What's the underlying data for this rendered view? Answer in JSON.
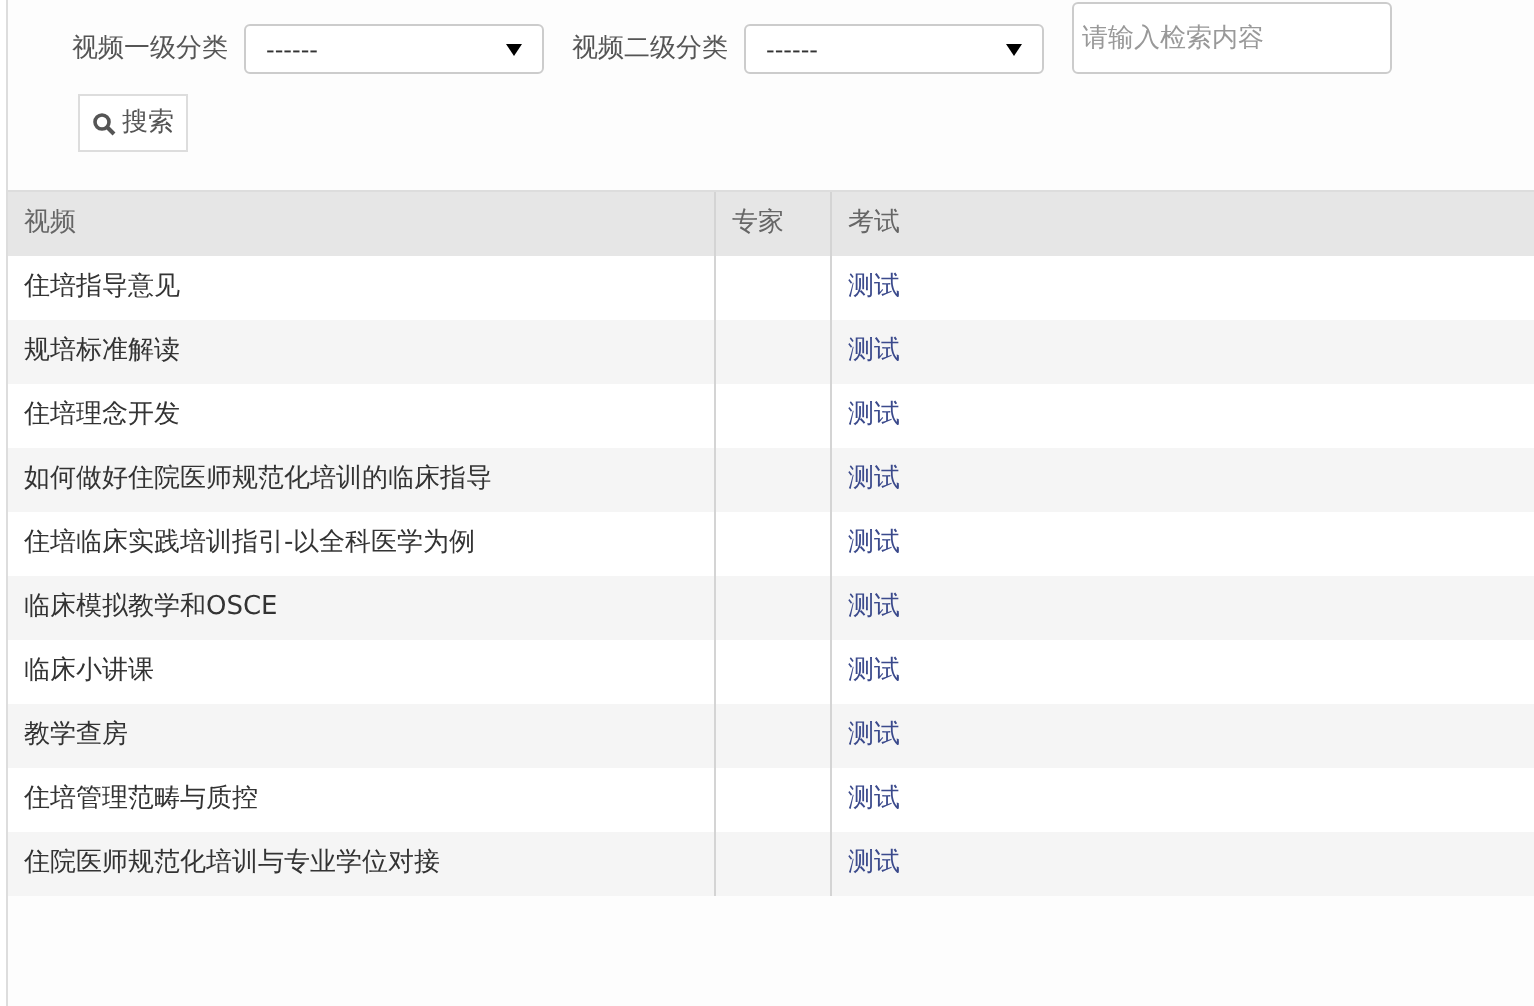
{
  "filters": [
    {
      "label": "视频一级分类",
      "value": "------"
    },
    {
      "label": "视频二级分类",
      "value": "------"
    }
  ],
  "search": {
    "placeholder": "请输入检索内容",
    "button": "搜索"
  },
  "table": {
    "columns": [
      "视频",
      "专家",
      "考试"
    ],
    "rows": [
      {
        "video": "住培指导意见",
        "exam": "测试"
      },
      {
        "video": "规培标准解读",
        "exam": "测试"
      },
      {
        "video": "住培理念开发",
        "exam": "测试"
      },
      {
        "video": "如何做好住院医师规范化培训的临床指导",
        "exam": "测试"
      },
      {
        "video": "住培临床实践培训指引-以全科医学为例",
        "exam": "测试"
      },
      {
        "video": "临床模拟教学和OSCE",
        "exam": "测试"
      },
      {
        "video": "临床小讲课",
        "exam": "测试"
      },
      {
        "video": "教学查房",
        "exam": "测试"
      },
      {
        "video": "住培管理范畴与质控",
        "exam": "测试"
      },
      {
        "video": "住院医师规范化培训与专业学位对接",
        "exam": "测试"
      }
    ]
  }
}
